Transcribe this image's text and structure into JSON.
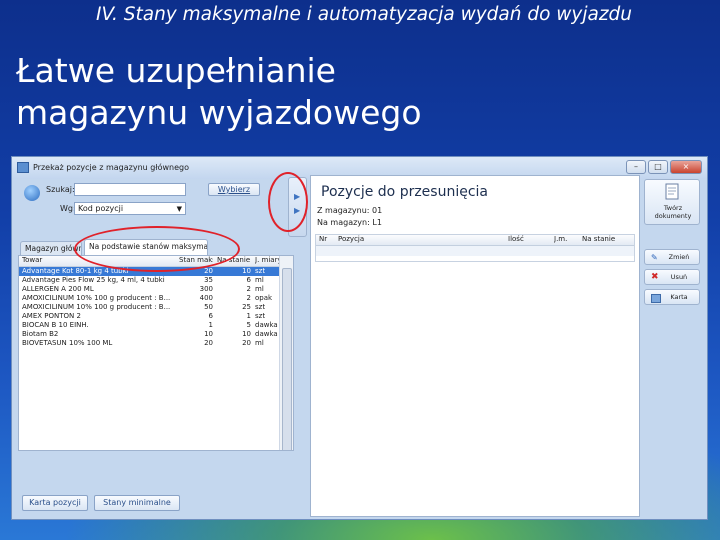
{
  "slide": {
    "subtitle": "IV. Stany maksymalne i automatyzacja wydań do wyjazdu",
    "title_line1": "Łatwe uzupełnianie",
    "title_line2": "magazynu wyjazdowego"
  },
  "window": {
    "title": "Przekaż pozycje z magazynu głównego",
    "controls": [
      "–",
      "□",
      "×"
    ]
  },
  "search": {
    "label": "Szukaj:",
    "value": "",
    "button": "Wybierz",
    "filter_label": "Wg:",
    "filter_value": "Kod pozycji"
  },
  "tabs": [
    {
      "label": "Magazyn główny"
    },
    {
      "label": "Na podstawie stanów maksymalnych"
    }
  ],
  "stock_table": {
    "columns": [
      "Towar",
      "Stan maks.",
      "Na stanie",
      "J. miary"
    ],
    "rows": [
      [
        "Advantage Kot 80-1 kg 4 tubki",
        "20",
        "10",
        "szt"
      ],
      [
        "Advantage Pies Flow 25 kg, 4 ml, 4 tubki",
        "35",
        "6",
        "ml"
      ],
      [
        "ALLERGEN A 200 ML",
        "300",
        "2",
        "ml"
      ],
      [
        "AMOXICILINUM 10% 100 g producent : B...",
        "400",
        "2",
        "opak"
      ],
      [
        "AMOXICILINUM 10% 100 g producent : B...",
        "50",
        "25",
        "szt"
      ],
      [
        "AMEX PONTON 2",
        "6",
        "1",
        "szt"
      ],
      [
        "BIOCAN B 10 EINH.",
        "1",
        "5",
        "dawka"
      ],
      [
        "Biotam B2",
        "10",
        "10",
        "dawka"
      ],
      [
        "BIOVETASUN 10% 100 ML",
        "20",
        "20",
        "ml"
      ]
    ]
  },
  "bottom_buttons": [
    "Karta pozycji",
    "Stany minimalne"
  ],
  "right_panel": {
    "title": "Pozycje do przesunięcia",
    "from_label": "Z magazynu:",
    "from_value": "01",
    "to_label": "Na magazyn:",
    "to_value": "L1",
    "columns": [
      "Nr",
      "Pozycja",
      "Ilość",
      "J.m.",
      "Na stanie"
    ]
  },
  "actions": {
    "create": "Twórz dokumenty",
    "edit": "Zmień",
    "delete": "Usuń",
    "card": "Karta"
  },
  "colors": {
    "highlight_ring": "#e0222a",
    "selection": "#3779d6"
  }
}
